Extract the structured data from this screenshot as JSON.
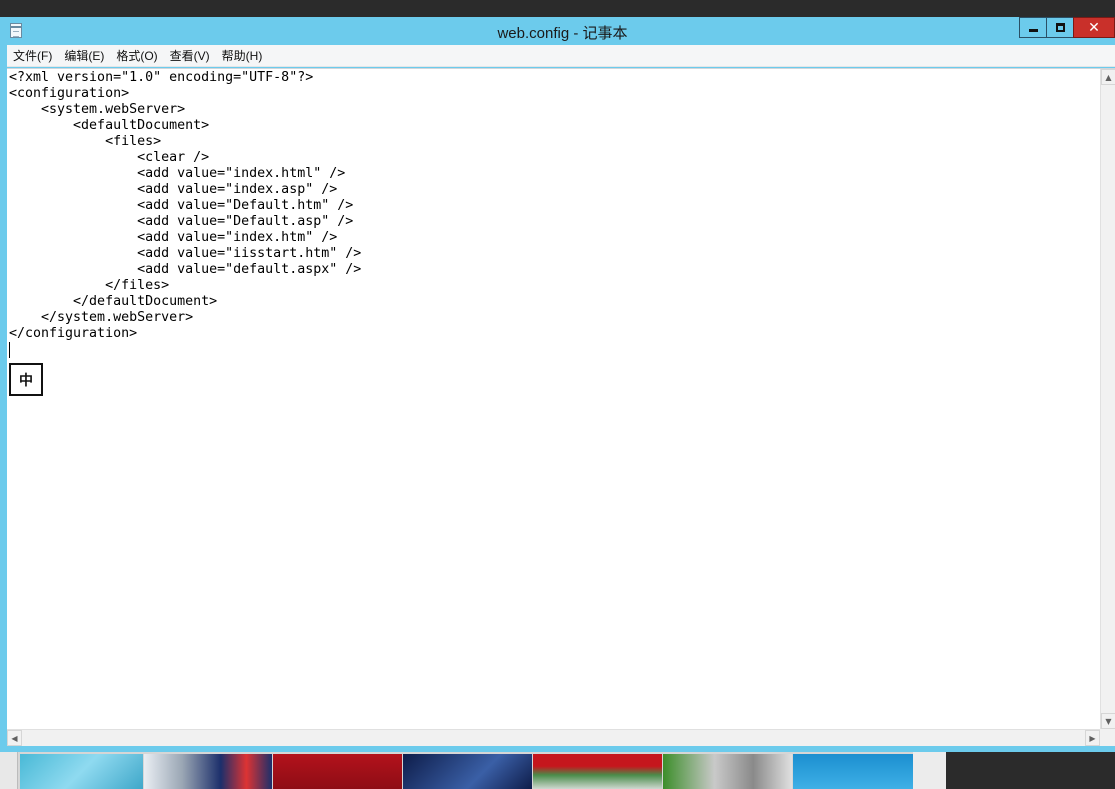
{
  "window": {
    "title": "web.config - 记事本",
    "close_glyph": "✕"
  },
  "menu": [
    {
      "label": "文件(F)"
    },
    {
      "label": "编辑(E)"
    },
    {
      "label": "格式(O)"
    },
    {
      "label": "查看(V)"
    },
    {
      "label": "帮助(H)"
    }
  ],
  "editor": {
    "text": "<?xml version=\"1.0\" encoding=\"UTF-8\"?>\n<configuration>\n    <system.webServer>\n        <defaultDocument>\n            <files>\n                <clear />\n                <add value=\"index.html\" />\n                <add value=\"index.asp\" />\n                <add value=\"Default.htm\" />\n                <add value=\"Default.asp\" />\n                <add value=\"index.htm\" />\n                <add value=\"iisstart.htm\" />\n                <add value=\"default.aspx\" />\n            </files>\n        </defaultDocument>\n    </system.webServer>\n</configuration>",
    "ime_indicator": "中"
  },
  "icons": {
    "app": "notepad-icon",
    "minimize": "minimize-icon",
    "maximize": "maximize-icon",
    "close": "close-icon"
  },
  "scrollbar": {
    "up_glyph": "▲",
    "down_glyph": "▼",
    "left_glyph": "◀",
    "right_glyph": "▶"
  },
  "colors": {
    "titlebar": "#6ccbec",
    "close_button": "#c9302a",
    "editor_bg": "#ffffff"
  }
}
